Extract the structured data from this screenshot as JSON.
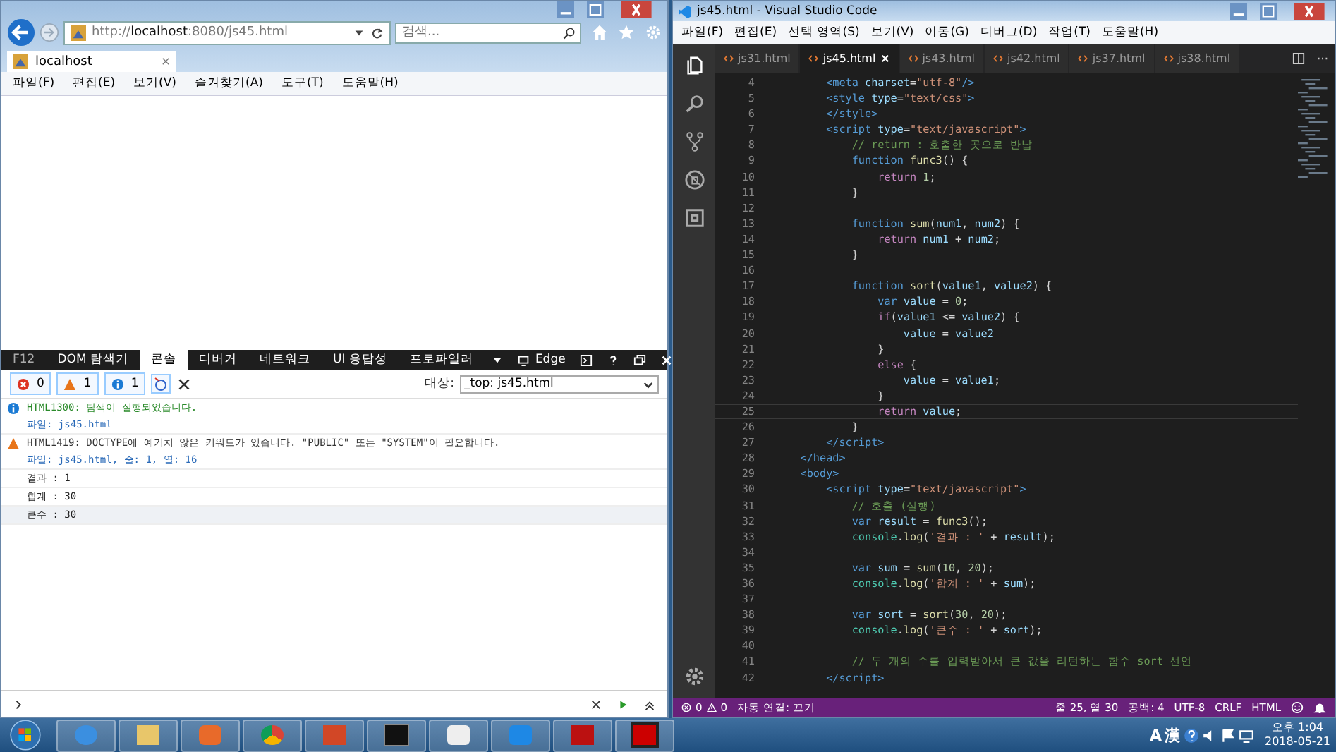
{
  "ie": {
    "url_prefix": "http://",
    "url_host": "localhost",
    "url_rest": ":8080/js45.html",
    "search": {
      "placeholder": "검색..."
    },
    "tabs": [
      {
        "label": "localhost",
        "selected": true
      }
    ],
    "menu": [
      "파일(F)",
      "편집(E)",
      "보기(V)",
      "즐겨찾기(A)",
      "도구(T)",
      "도움말(H)"
    ],
    "devtools": {
      "tabs": [
        {
          "label": "F12",
          "selected": false
        },
        {
          "label": "DOM 탐색기",
          "selected": false
        },
        {
          "label": "콘솔",
          "selected": true
        },
        {
          "label": "디버거",
          "selected": false
        },
        {
          "label": "네트워크",
          "selected": false
        },
        {
          "label": "UI 응답성",
          "selected": false
        },
        {
          "label": "프로파일러",
          "selected": false
        }
      ],
      "emulation": "Edge",
      "counts": {
        "errors": "0",
        "warnings": "1",
        "info": "1"
      },
      "target_label": "대상:",
      "target_value": "_top: js45.html",
      "messages": [
        {
          "kind": "info",
          "text": "HTML1300: 탐색이 실행되었습니다.",
          "detail": "파일: js45.html"
        },
        {
          "kind": "warn",
          "text": "HTML1419: DOCTYPE에 예기치 않은 키워드가 있습니다. \"PUBLIC\" 또는 \"SYSTEM\"이 필요합니다.",
          "detail": "파일: js45.html, 줄: 1, 열: 16"
        },
        {
          "kind": "log",
          "text": "결과 : 1"
        },
        {
          "kind": "log",
          "text": "합계 : 30"
        },
        {
          "kind": "log",
          "text": "큰수 : 30"
        }
      ]
    }
  },
  "vscode": {
    "title": "js45.html - Visual Studio Code",
    "menu": [
      "파일(F)",
      "편집(E)",
      "선택 영역(S)",
      "보기(V)",
      "이동(G)",
      "디버그(D)",
      "작업(T)",
      "도움말(H)"
    ],
    "tabs": [
      {
        "label": "js31.html",
        "selected": false
      },
      {
        "label": "js45.html",
        "selected": true
      },
      {
        "label": "js43.html",
        "selected": false
      },
      {
        "label": "js42.html",
        "selected": false
      },
      {
        "label": "js37.html",
        "selected": false
      },
      {
        "label": "js38.html",
        "selected": false
      }
    ],
    "lines": [
      {
        "n": "4",
        "current": false,
        "tokens": [
          {
            "kind": "tag",
            "text": "        <meta"
          },
          {
            "kind": "attr",
            "text": " charset"
          },
          {
            "kind": "plain",
            "text": "="
          },
          {
            "kind": "str",
            "text": "\"utf-8\""
          },
          {
            "kind": "tag",
            "text": "/>"
          }
        ]
      },
      {
        "n": "5",
        "current": false,
        "tokens": [
          {
            "kind": "tag",
            "text": "        <style"
          },
          {
            "kind": "attr",
            "text": " type"
          },
          {
            "kind": "plain",
            "text": "="
          },
          {
            "kind": "str",
            "text": "\"text/css\""
          },
          {
            "kind": "tag",
            "text": ">"
          }
        ]
      },
      {
        "n": "6",
        "current": false,
        "tokens": [
          {
            "kind": "tag",
            "text": "        </style>"
          }
        ]
      },
      {
        "n": "7",
        "current": false,
        "tokens": [
          {
            "kind": "tag",
            "text": "        <script"
          },
          {
            "kind": "attr",
            "text": " type"
          },
          {
            "kind": "plain",
            "text": "="
          },
          {
            "kind": "str",
            "text": "\"text/javascript\""
          },
          {
            "kind": "tag",
            "text": ">"
          }
        ]
      },
      {
        "n": "8",
        "current": false,
        "tokens": [
          {
            "kind": "com",
            "text": "            // return : 호출한 곳으로 반납"
          }
        ]
      },
      {
        "n": "9",
        "current": false,
        "tokens": [
          {
            "kind": "kw",
            "text": "            function"
          },
          {
            "kind": "fn",
            "text": " func3"
          },
          {
            "kind": "plain",
            "text": "() {"
          }
        ]
      },
      {
        "n": "10",
        "current": false,
        "tokens": [
          {
            "kind": "ctl",
            "text": "                return"
          },
          {
            "kind": "num",
            "text": " 1"
          },
          {
            "kind": "plain",
            "text": ";"
          }
        ]
      },
      {
        "n": "11",
        "current": false,
        "tokens": [
          {
            "kind": "plain",
            "text": "            }"
          }
        ]
      },
      {
        "n": "12",
        "current": false
      },
      {
        "n": "13",
        "current": false,
        "tokens": [
          {
            "kind": "kw",
            "text": "            function"
          },
          {
            "kind": "fn",
            "text": " sum"
          },
          {
            "kind": "plain",
            "text": "("
          },
          {
            "kind": "var",
            "text": "num1"
          },
          {
            "kind": "plain",
            "text": ", "
          },
          {
            "kind": "var",
            "text": "num2"
          },
          {
            "kind": "plain",
            "text": ") {"
          }
        ]
      },
      {
        "n": "14",
        "current": false,
        "tokens": [
          {
            "kind": "ctl",
            "text": "                return"
          },
          {
            "kind": "var",
            "text": " num1"
          },
          {
            "kind": "plain",
            "text": " + "
          },
          {
            "kind": "var",
            "text": "num2"
          },
          {
            "kind": "plain",
            "text": ";"
          }
        ]
      },
      {
        "n": "15",
        "current": false,
        "tokens": [
          {
            "kind": "plain",
            "text": "            }"
          }
        ]
      },
      {
        "n": "16",
        "current": false
      },
      {
        "n": "17",
        "current": false,
        "tokens": [
          {
            "kind": "kw",
            "text": "            function"
          },
          {
            "kind": "fn",
            "text": " sort"
          },
          {
            "kind": "plain",
            "text": "("
          },
          {
            "kind": "var",
            "text": "value1"
          },
          {
            "kind": "plain",
            "text": ", "
          },
          {
            "kind": "var",
            "text": "value2"
          },
          {
            "kind": "plain",
            "text": ") {"
          }
        ]
      },
      {
        "n": "18",
        "current": false,
        "tokens": [
          {
            "kind": "kw",
            "text": "                var"
          },
          {
            "kind": "var",
            "text": " value"
          },
          {
            "kind": "plain",
            "text": " = "
          },
          {
            "kind": "num",
            "text": "0"
          },
          {
            "kind": "plain",
            "text": ";"
          }
        ]
      },
      {
        "n": "19",
        "current": false,
        "tokens": [
          {
            "kind": "ctl",
            "text": "                if"
          },
          {
            "kind": "plain",
            "text": "("
          },
          {
            "kind": "var",
            "text": "value1"
          },
          {
            "kind": "plain",
            "text": " <= "
          },
          {
            "kind": "var",
            "text": "value2"
          },
          {
            "kind": "plain",
            "text": ") {"
          }
        ]
      },
      {
        "n": "20",
        "current": false,
        "tokens": [
          {
            "kind": "var",
            "text": "                    value"
          },
          {
            "kind": "plain",
            "text": " = "
          },
          {
            "kind": "var",
            "text": "value2"
          }
        ]
      },
      {
        "n": "21",
        "current": false,
        "tokens": [
          {
            "kind": "plain",
            "text": "                }"
          }
        ]
      },
      {
        "n": "22",
        "current": false,
        "tokens": [
          {
            "kind": "ctl",
            "text": "                else"
          },
          {
            "kind": "plain",
            "text": " {"
          }
        ]
      },
      {
        "n": "23",
        "current": false,
        "tokens": [
          {
            "kind": "var",
            "text": "                    value"
          },
          {
            "kind": "plain",
            "text": " = "
          },
          {
            "kind": "var",
            "text": "value1"
          },
          {
            "kind": "plain",
            "text": ";"
          }
        ]
      },
      {
        "n": "24",
        "current": false,
        "tokens": [
          {
            "kind": "plain",
            "text": "                }"
          }
        ]
      },
      {
        "n": "25",
        "current": true,
        "tokens": [
          {
            "kind": "ctl",
            "text": "                return"
          },
          {
            "kind": "var",
            "text": " value"
          },
          {
            "kind": "plain",
            "text": ";"
          }
        ]
      },
      {
        "n": "26",
        "current": false,
        "tokens": [
          {
            "kind": "plain",
            "text": "            }"
          }
        ]
      },
      {
        "n": "27",
        "current": false,
        "tokens": [
          {
            "kind": "tag",
            "text": "        </script>"
          }
        ]
      },
      {
        "n": "28",
        "current": false,
        "tokens": [
          {
            "kind": "tag",
            "text": "    </head>"
          }
        ]
      },
      {
        "n": "29",
        "current": false,
        "tokens": [
          {
            "kind": "tag",
            "text": "    <body>"
          }
        ]
      },
      {
        "n": "30",
        "current": false,
        "tokens": [
          {
            "kind": "tag",
            "text": "        <script"
          },
          {
            "kind": "attr",
            "text": " type"
          },
          {
            "kind": "plain",
            "text": "="
          },
          {
            "kind": "str",
            "text": "\"text/javascript\""
          },
          {
            "kind": "tag",
            "text": ">"
          }
        ]
      },
      {
        "n": "31",
        "current": false,
        "tokens": [
          {
            "kind": "com",
            "text": "            // 호출 (실행)"
          }
        ]
      },
      {
        "n": "32",
        "current": false,
        "tokens": [
          {
            "kind": "kw",
            "text": "            var"
          },
          {
            "kind": "var",
            "text": " result"
          },
          {
            "kind": "plain",
            "text": " = "
          },
          {
            "kind": "fn",
            "text": "func3"
          },
          {
            "kind": "plain",
            "text": "();"
          }
        ]
      },
      {
        "n": "33",
        "current": false,
        "tokens": [
          {
            "kind": "cls",
            "text": "            console"
          },
          {
            "kind": "plain",
            "text": "."
          },
          {
            "kind": "fn",
            "text": "log"
          },
          {
            "kind": "plain",
            "text": "("
          },
          {
            "kind": "str",
            "text": "'결과 : '"
          },
          {
            "kind": "plain",
            "text": " + "
          },
          {
            "kind": "var",
            "text": "result"
          },
          {
            "kind": "plain",
            "text": ");"
          }
        ]
      },
      {
        "n": "34",
        "current": false
      },
      {
        "n": "35",
        "current": false,
        "tokens": [
          {
            "kind": "kw",
            "text": "            var"
          },
          {
            "kind": "var",
            "text": " sum"
          },
          {
            "kind": "plain",
            "text": " = "
          },
          {
            "kind": "fn",
            "text": "sum"
          },
          {
            "kind": "plain",
            "text": "("
          },
          {
            "kind": "num",
            "text": "10"
          },
          {
            "kind": "plain",
            "text": ", "
          },
          {
            "kind": "num",
            "text": "20"
          },
          {
            "kind": "plain",
            "text": ");"
          }
        ]
      },
      {
        "n": "36",
        "current": false,
        "tokens": [
          {
            "kind": "cls",
            "text": "            console"
          },
          {
            "kind": "plain",
            "text": "."
          },
          {
            "kind": "fn",
            "text": "log"
          },
          {
            "kind": "plain",
            "text": "("
          },
          {
            "kind": "str",
            "text": "'합계 : '"
          },
          {
            "kind": "plain",
            "text": " + "
          },
          {
            "kind": "var",
            "text": "sum"
          },
          {
            "kind": "plain",
            "text": ");"
          }
        ]
      },
      {
        "n": "37",
        "current": false
      },
      {
        "n": "38",
        "current": false,
        "tokens": [
          {
            "kind": "kw",
            "text": "            var"
          },
          {
            "kind": "var",
            "text": " sort"
          },
          {
            "kind": "plain",
            "text": " = "
          },
          {
            "kind": "fn",
            "text": "sort"
          },
          {
            "kind": "plain",
            "text": "("
          },
          {
            "kind": "num",
            "text": "30"
          },
          {
            "kind": "plain",
            "text": ", "
          },
          {
            "kind": "num",
            "text": "20"
          },
          {
            "kind": "plain",
            "text": ");"
          }
        ]
      },
      {
        "n": "39",
        "current": false,
        "tokens": [
          {
            "kind": "cls",
            "text": "            console"
          },
          {
            "kind": "plain",
            "text": "."
          },
          {
            "kind": "fn",
            "text": "log"
          },
          {
            "kind": "plain",
            "text": "("
          },
          {
            "kind": "str",
            "text": "'큰수 : '"
          },
          {
            "kind": "plain",
            "text": " + "
          },
          {
            "kind": "var",
            "text": "sort"
          },
          {
            "kind": "plain",
            "text": ");"
          }
        ]
      },
      {
        "n": "40",
        "current": false
      },
      {
        "n": "41",
        "current": false,
        "tokens": [
          {
            "kind": "com",
            "text": "            // 두 개의 수를 입력받아서 큰 값을 리턴하는 함수 sort 선언"
          }
        ]
      },
      {
        "n": "42",
        "current": false,
        "tokens": [
          {
            "kind": "tag",
            "text": "        </script>"
          }
        ]
      }
    ],
    "status": {
      "errors": "0",
      "warnings": "0",
      "live": "자동 연결: 끄기",
      "position": "줄 25, 열 30",
      "spaces": "공백: 4",
      "encoding": "UTF-8",
      "eol": "CRLF",
      "language": "HTML"
    }
  },
  "taskbar": {
    "ime_a": "A",
    "ime_han": "漢",
    "time": "오후 1:04",
    "date": "2018-05-21"
  }
}
